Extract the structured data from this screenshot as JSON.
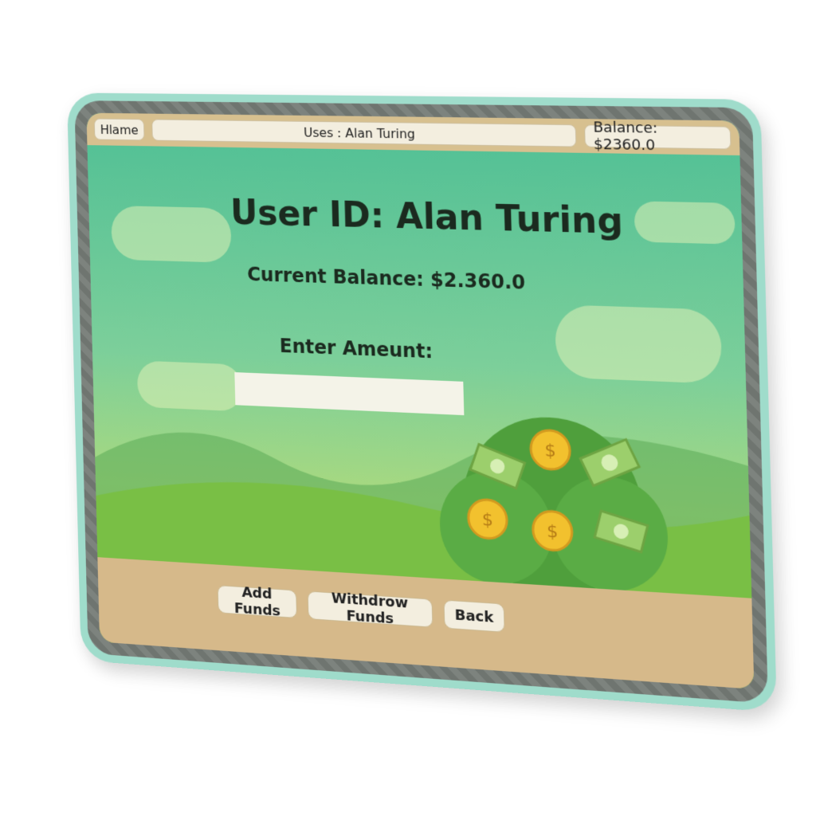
{
  "topbar": {
    "home_label": "Hlame",
    "user_label": "Uses : Alan Turing",
    "balance_label": "Balance: $2360.0"
  },
  "main": {
    "title": "User ID: Alan Turing",
    "current_balance": "Current Balance:  $2.360.0",
    "amount_label": "Enter Ameunt:",
    "amount_value": ""
  },
  "actions": {
    "add": "Add Funds",
    "withdraw": "Withdrow Funds",
    "back": "Back"
  },
  "colors": {
    "bezel_edge": "#9fdccb",
    "screen_top": "#4fbf95",
    "grass": "#7fc247",
    "footer": "#d6b98a",
    "coin": "#f2c12e",
    "leaves": "#4f9f3c"
  },
  "icons": {
    "coin": "dollar-coin-icon",
    "bill": "money-bill-icon"
  }
}
